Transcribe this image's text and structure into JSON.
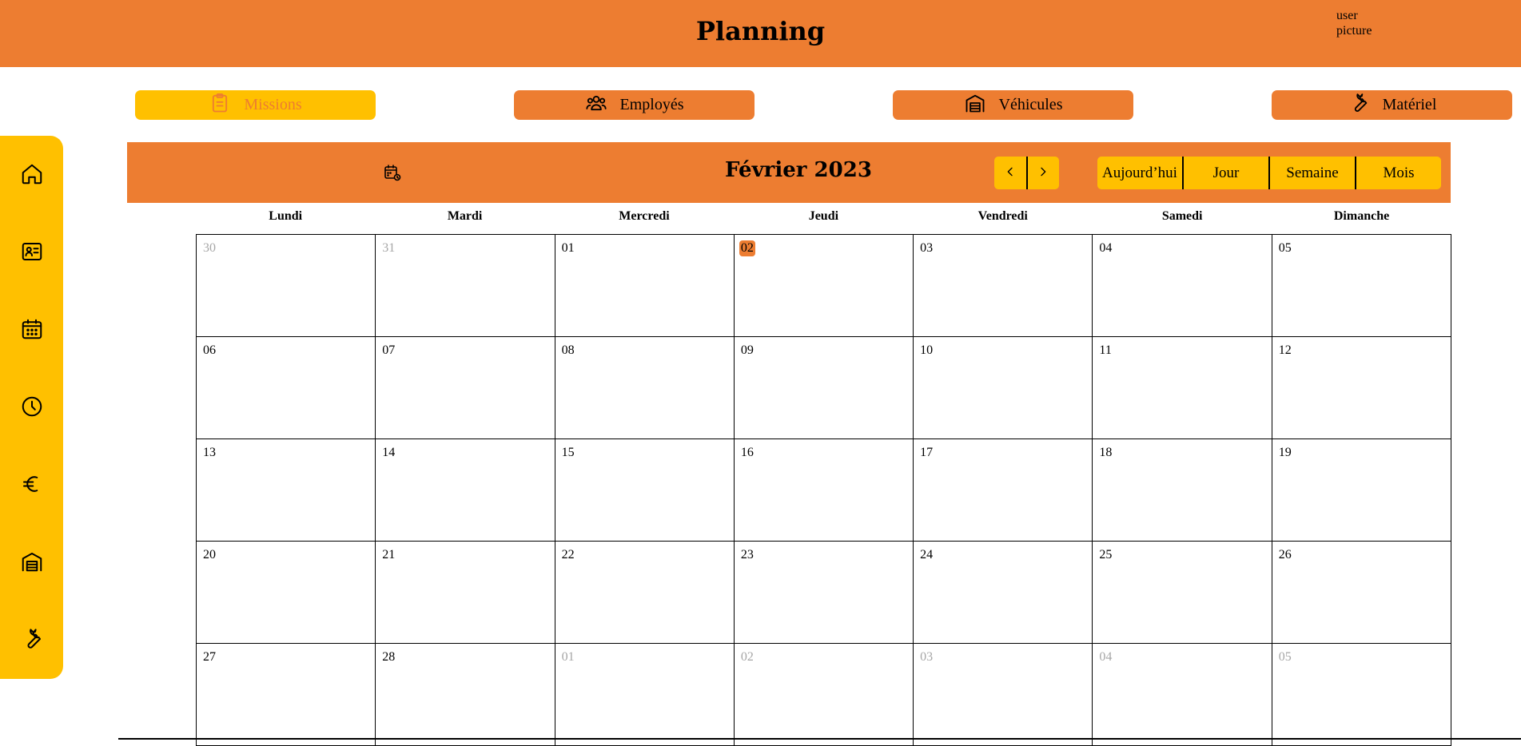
{
  "header": {
    "title": "Planning",
    "user_picture": "user picture"
  },
  "topnav": [
    {
      "label": "Missions",
      "icon": "clipboard-icon",
      "active": true
    },
    {
      "label": "Employés",
      "icon": "users-icon",
      "active": false
    },
    {
      "label": "Véhicules",
      "icon": "garage-icon",
      "active": false
    },
    {
      "label": "Matériel",
      "icon": "wrench-icon",
      "active": false
    }
  ],
  "sidebar": [
    {
      "icon": "home-icon"
    },
    {
      "icon": "id-card-icon"
    },
    {
      "icon": "calendar-icon"
    },
    {
      "icon": "clock-icon"
    },
    {
      "icon": "euro-icon"
    },
    {
      "icon": "garage-icon"
    },
    {
      "icon": "wrench-icon"
    }
  ],
  "calendar": {
    "month_label": "Février 2023",
    "add_icon": "calendar-add-icon",
    "nav": {
      "prev": "chevron-left-icon",
      "next": "chevron-right-icon"
    },
    "views": [
      "Aujourd’hui",
      "Jour",
      "Semaine",
      "Mois"
    ],
    "weekdays": [
      "Lundi",
      "Mardi",
      "Mercredi",
      "Jeudi",
      "Vendredi",
      "Samedi",
      "Dimanche"
    ],
    "today": "02",
    "weeks": [
      [
        {
          "d": "30",
          "other": true
        },
        {
          "d": "31",
          "other": true
        },
        {
          "d": "01"
        },
        {
          "d": "02",
          "today": true
        },
        {
          "d": "03"
        },
        {
          "d": "04"
        },
        {
          "d": "05"
        }
      ],
      [
        {
          "d": "06"
        },
        {
          "d": "07"
        },
        {
          "d": "08"
        },
        {
          "d": "09"
        },
        {
          "d": "10"
        },
        {
          "d": "11"
        },
        {
          "d": "12"
        }
      ],
      [
        {
          "d": "13"
        },
        {
          "d": "14"
        },
        {
          "d": "15"
        },
        {
          "d": "16"
        },
        {
          "d": "17"
        },
        {
          "d": "18"
        },
        {
          "d": "19"
        }
      ],
      [
        {
          "d": "20"
        },
        {
          "d": "21"
        },
        {
          "d": "22"
        },
        {
          "d": "23"
        },
        {
          "d": "24"
        },
        {
          "d": "25"
        },
        {
          "d": "26"
        }
      ],
      [
        {
          "d": "27"
        },
        {
          "d": "28"
        },
        {
          "d": "01",
          "other": true
        },
        {
          "d": "02",
          "other": true
        },
        {
          "d": "03",
          "other": true
        },
        {
          "d": "04",
          "other": true
        },
        {
          "d": "05",
          "other": true
        }
      ]
    ]
  },
  "colors": {
    "orange": "#ED7D31",
    "yellow": "#FFC000",
    "muted_day": "#a6a6a6"
  }
}
